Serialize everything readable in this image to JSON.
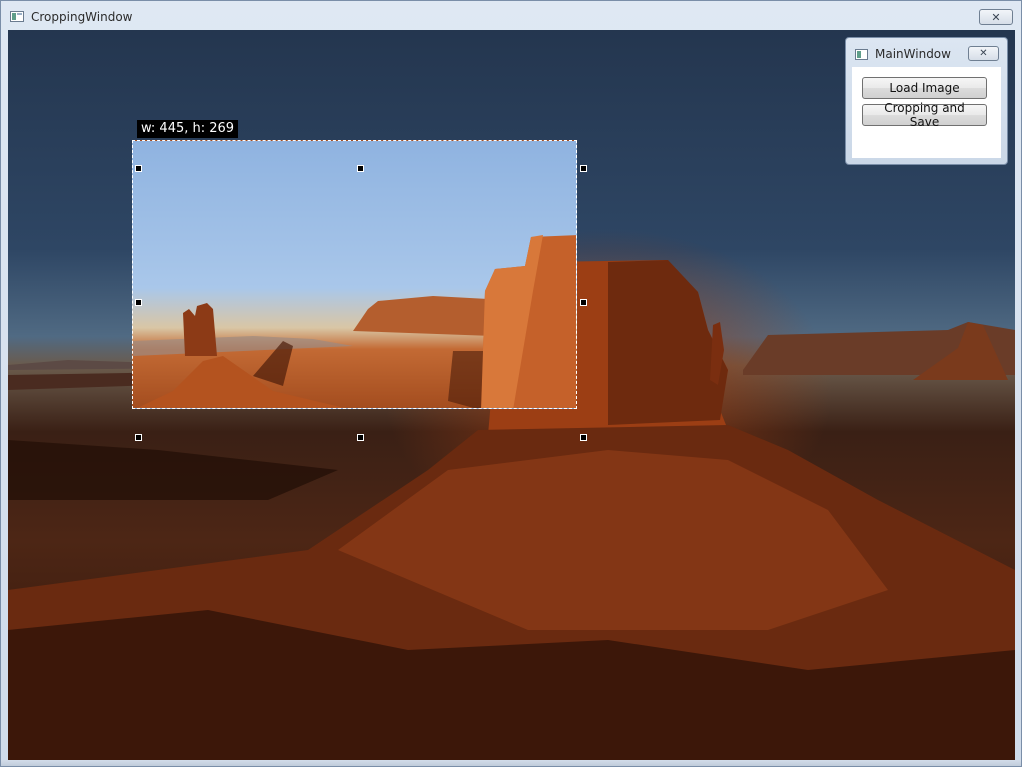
{
  "crop_window": {
    "title": "CroppingWindow",
    "icon": "app-window-icon",
    "close_icon": "close-icon",
    "close_glyph": "✕"
  },
  "selection": {
    "size_label": "w: 445, h: 269",
    "width": 445,
    "height": 269
  },
  "main_window": {
    "title": "MainWindow",
    "close_glyph": "✕",
    "buttons": {
      "load_label": "Load Image",
      "crop_label": "Cropping and Save"
    }
  },
  "colors": {
    "selection_border": "#ffffff",
    "handle_fill": "#000000",
    "sky_dark": "#2e4664",
    "desert_red": "#a44d1f"
  }
}
